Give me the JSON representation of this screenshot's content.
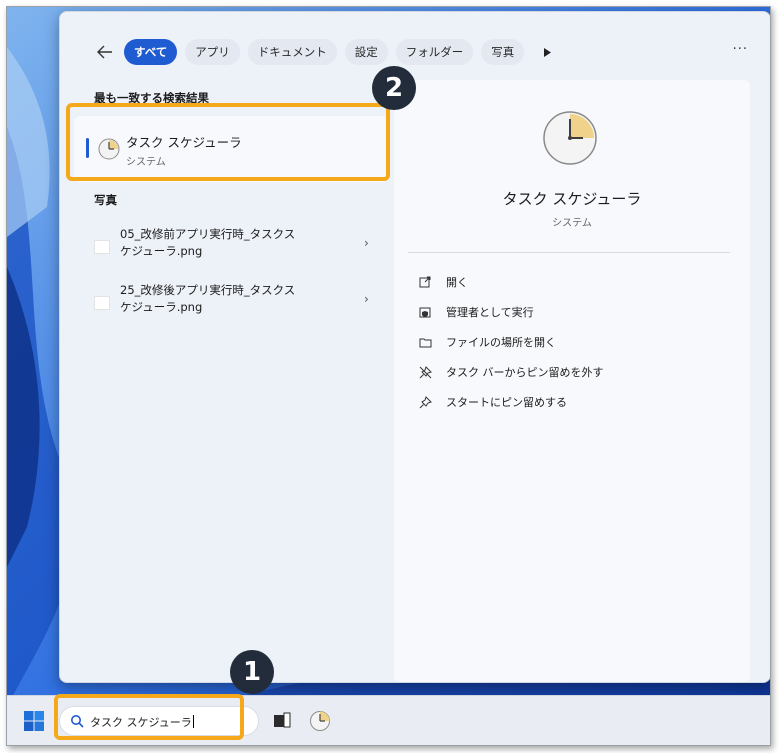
{
  "search_panel": {
    "tabs": [
      "すべて",
      "アプリ",
      "ドキュメント",
      "設定",
      "フォルダー",
      "写真"
    ],
    "best_match_heading": "最も一致する検索結果",
    "best_match": {
      "title": "タスク スケジューラ",
      "subtitle": "システム",
      "icon": "task-scheduler-clock-icon"
    },
    "photos_heading": "写真",
    "photos": [
      {
        "line1": "05_改修前アプリ実行時_タスクス",
        "line2": "ケジューラ.png"
      },
      {
        "line1": "25_改修後アプリ実行時_タスクス",
        "line2": "ケジューラ.png"
      }
    ],
    "detail": {
      "app_name": "タスク スケジューラ",
      "category": "システム",
      "actions": [
        {
          "label": "開く",
          "icon": "open-icon"
        },
        {
          "label": "管理者として実行",
          "icon": "shield-icon"
        },
        {
          "label": "ファイルの場所を開く",
          "icon": "folder-icon"
        },
        {
          "label": "タスク バーからピン留めを外す",
          "icon": "unpin-icon"
        },
        {
          "label": "スタートにピン留めする",
          "icon": "pin-icon"
        }
      ]
    }
  },
  "taskbar": {
    "search_value": "タスク スケジューラ"
  },
  "annotations": {
    "badge_1": "1",
    "badge_2": "2",
    "highlight_color": "#f4a81a"
  },
  "colors": {
    "accent": "#1f5bd1",
    "panel_bg": "#edf1f8",
    "badge_bg": "#232c3b"
  }
}
